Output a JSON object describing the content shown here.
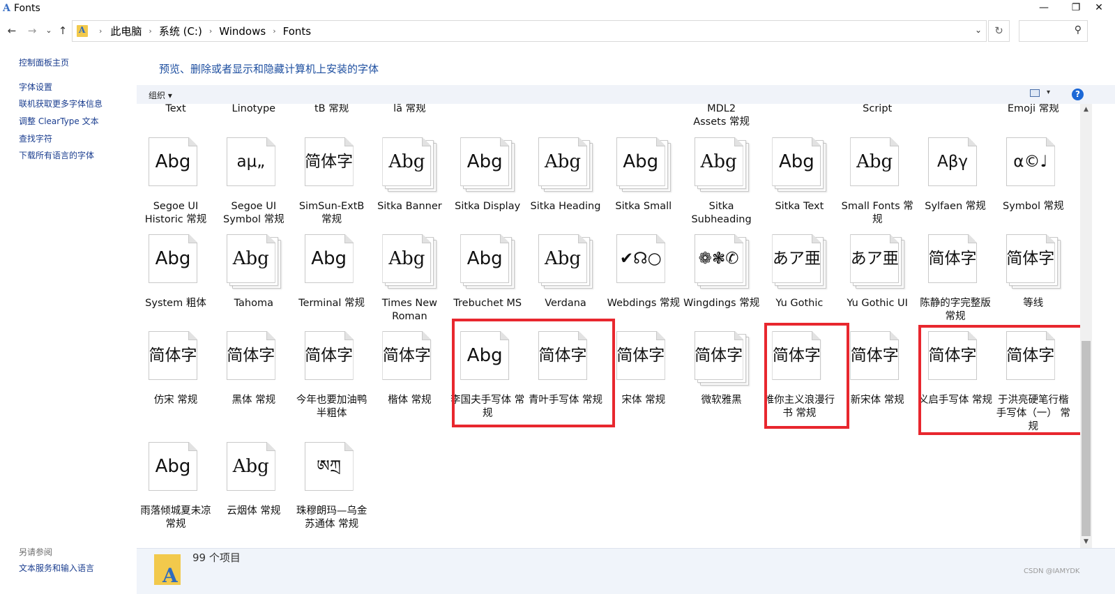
{
  "window": {
    "title": "Fonts",
    "minimize": "—",
    "maximize": "❐",
    "close": "✕"
  },
  "nav": {
    "back": "←",
    "forward": "→",
    "recent": "⌄",
    "up": "↑",
    "breadcrumb": [
      "此电脑",
      "系统 (C:)",
      "Windows",
      "Fonts"
    ],
    "refresh": "↻",
    "search_icon": "⚲"
  },
  "sidebar": {
    "home": "控制面板主页",
    "links": [
      "字体设置",
      "联机获取更多字体信息",
      "调整 ClearType 文本",
      "查找字符",
      "下载所有语言的字体"
    ],
    "see_also": "另请参阅",
    "see_also_links": [
      "文本服务和输入语言"
    ]
  },
  "heading": "预览、删除或者显示和隐藏计算机上安装的字体",
  "toolbar": {
    "organize": "组织 ▾",
    "view_dropdown": "▾",
    "help": "?"
  },
  "partial_labels": [
    "Text",
    "Linotype",
    "tB 常规",
    "lã 常规",
    "",
    "",
    "",
    "MDL2\nAssets 常规",
    "",
    "Script",
    "",
    "Emoji 常规"
  ],
  "rows": [
    [
      {
        "sample": "Abg",
        "label": "Segoe UI Historic 常规",
        "stack": 1
      },
      {
        "sample": "aμ„",
        "label": "Segoe UI Symbol 常规",
        "stack": 1
      },
      {
        "sample": "简体字",
        "label": "SimSun-ExtB 常规",
        "stack": 1
      },
      {
        "sample": "Abg",
        "label": "Sitka Banner",
        "stack": 3
      },
      {
        "sample": "Abg",
        "label": "Sitka Display",
        "stack": 3
      },
      {
        "sample": "Abg",
        "label": "Sitka Heading",
        "stack": 3
      },
      {
        "sample": "Abg",
        "label": "Sitka Small",
        "stack": 3
      },
      {
        "sample": "Abg",
        "label": "Sitka Subheading",
        "stack": 3
      },
      {
        "sample": "Abg",
        "label": "Sitka Text",
        "stack": 3
      },
      {
        "sample": "Abg",
        "label": "Small Fonts 常规",
        "stack": 1
      },
      {
        "sample": "Αβγ",
        "label": "Sylfaen 常规",
        "stack": 1
      },
      {
        "sample": "α©♩",
        "label": "Symbol 常规",
        "stack": 1
      }
    ],
    [
      {
        "sample": "Abg",
        "label": "System 粗体",
        "stack": 1
      },
      {
        "sample": "Abg",
        "label": "Tahoma",
        "stack": 3
      },
      {
        "sample": "Abg",
        "label": "Terminal 常规",
        "stack": 1
      },
      {
        "sample": "Abg",
        "label": "Times New Roman",
        "stack": 3
      },
      {
        "sample": "Abg",
        "label": "Trebuchet MS",
        "stack": 3
      },
      {
        "sample": "Abg",
        "label": "Verdana",
        "stack": 3
      },
      {
        "sample": "✔☊○",
        "label": "Webdings 常规",
        "stack": 1
      },
      {
        "sample": "❁❃✆",
        "label": "Wingdings 常规",
        "stack": 3
      },
      {
        "sample": "あア亜",
        "label": "Yu Gothic",
        "stack": 3
      },
      {
        "sample": "あア亜",
        "label": "Yu Gothic UI",
        "stack": 3
      },
      {
        "sample": "简体字",
        "label": "陈静的字完整版 常规",
        "stack": 1
      },
      {
        "sample": "简体字",
        "label": "等线",
        "stack": 3
      }
    ],
    [
      {
        "sample": "简体字",
        "label": "仿宋 常规",
        "stack": 1
      },
      {
        "sample": "简体字",
        "label": "黑体 常规",
        "stack": 1
      },
      {
        "sample": "简体字",
        "label": "今年也要加油鸭 半粗体",
        "stack": 1
      },
      {
        "sample": "简体字",
        "label": "楷体 常规",
        "stack": 1
      },
      {
        "sample": "Abg",
        "label": "李国夫手写体 常规",
        "stack": 1
      },
      {
        "sample": "简体字",
        "label": "青叶手写体 常规",
        "stack": 1
      },
      {
        "sample": "简体字",
        "label": "宋体 常规",
        "stack": 1
      },
      {
        "sample": "简体字",
        "label": "微软雅黑",
        "stack": 3
      },
      {
        "sample": "简体字",
        "label": "唯你主义浪漫行书 常规",
        "stack": 1
      },
      {
        "sample": "简体字",
        "label": "新宋体 常规",
        "stack": 1
      },
      {
        "sample": "简体字",
        "label": "义启手写体 常规",
        "stack": 1
      },
      {
        "sample": "简体字",
        "label": "于洪亮硬笔行楷手写体（一） 常规",
        "stack": 1
      }
    ],
    [
      {
        "sample": "Abg",
        "label": "雨落倾城夏未凉 常规",
        "stack": 1
      },
      {
        "sample": "Abg",
        "label": "云烟体 常规",
        "stack": 1
      },
      {
        "sample": "ཨཀྲ",
        "label": "珠穆朗玛—乌金苏通体 常规",
        "stack": 1
      }
    ]
  ],
  "status": {
    "count": "99 个项目"
  },
  "watermark": "CSDN @IAMYDK",
  "colors": {
    "highlight": "#e8272e",
    "link": "#1a3d8f",
    "heading": "#1e4fa0"
  }
}
